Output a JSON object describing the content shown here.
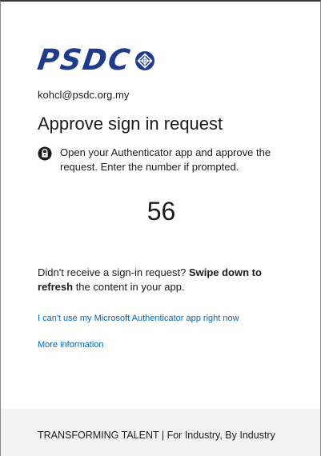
{
  "logo": {
    "text": "PSDC",
    "brand_color": "#1f3c8c",
    "mark_icon": "diamond-emblem-icon"
  },
  "account": {
    "email": "kohcl@psdc.org.my"
  },
  "page": {
    "title": "Approve sign in request"
  },
  "instruction": {
    "icon": "lock-icon",
    "text": "Open your Authenticator app and approve the request. Enter the number if prompted."
  },
  "code": {
    "number": "56"
  },
  "hint": {
    "prefix": "Didn't receive a sign-in request? ",
    "bold_1": "Swipe down to",
    "bold_2": "refresh",
    "suffix": " the content in your app."
  },
  "links": {
    "cant_use": "I can't use my Microsoft Authenticator app right now",
    "more_info": "More information",
    "link_color": "#0067b8"
  },
  "footer": {
    "text": "TRANSFORMING TALENT | For Industry, By Industry",
    "background": "#f2f2f2"
  }
}
